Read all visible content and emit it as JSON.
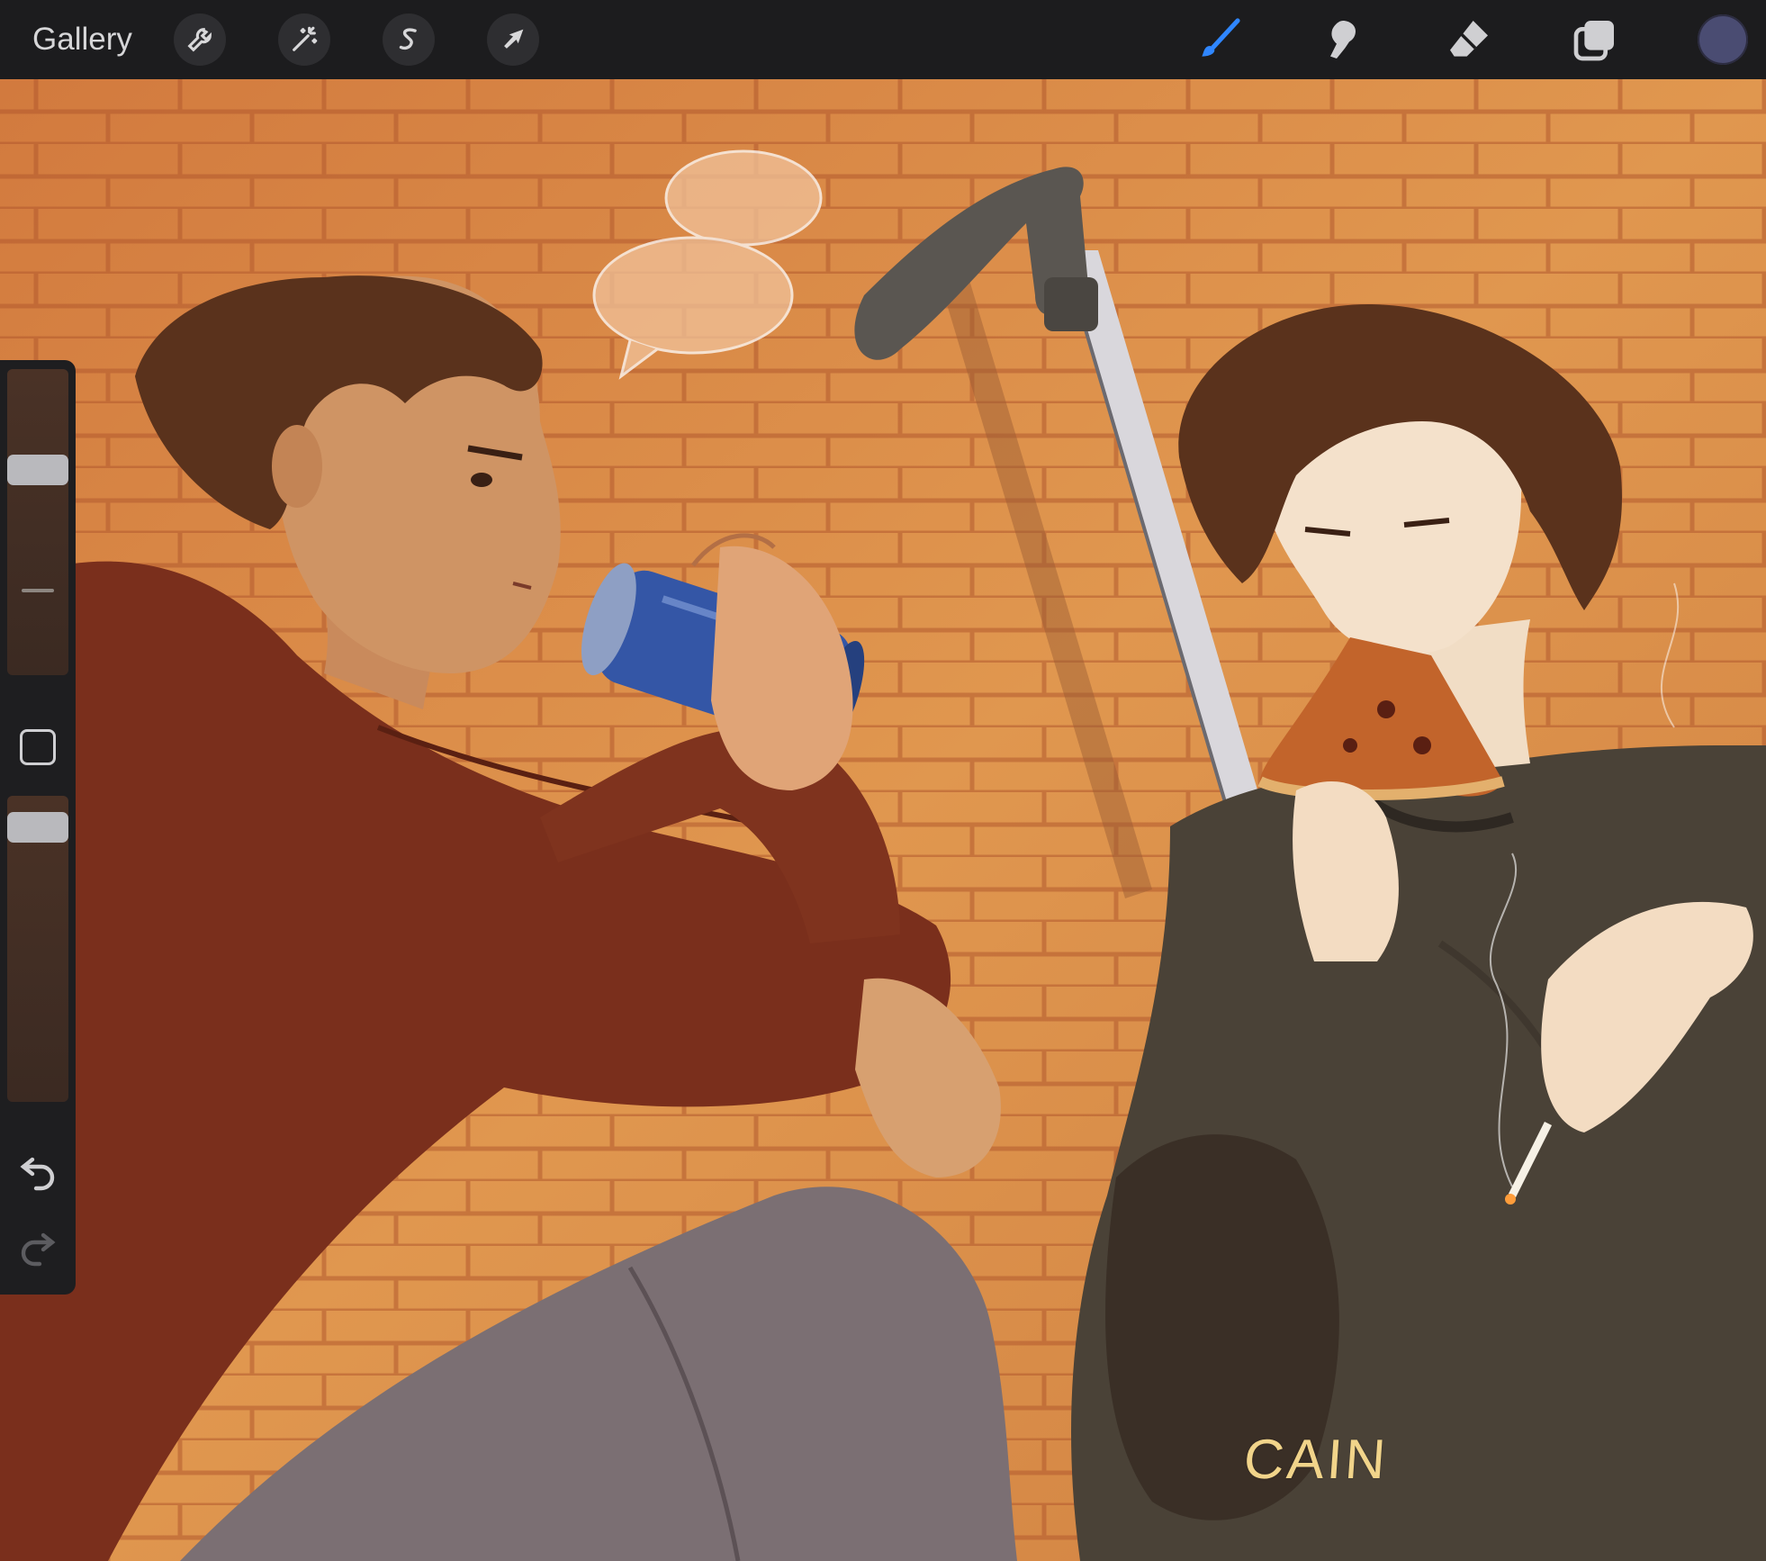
{
  "toolbar": {
    "gallery_label": "Gallery",
    "left_tools": [
      {
        "name": "actions",
        "icon": "wrench-icon"
      },
      {
        "name": "adjustments",
        "icon": "magic-wand-icon"
      },
      {
        "name": "selection",
        "icon": "selection-s-icon"
      },
      {
        "name": "transform",
        "icon": "arrow-cursor-icon"
      }
    ],
    "right_tools": [
      {
        "name": "brush",
        "icon": "brush-icon",
        "active": true,
        "color": "#2f86ff"
      },
      {
        "name": "smudge",
        "icon": "smudge-finger-icon",
        "active": false
      },
      {
        "name": "eraser",
        "icon": "eraser-icon",
        "active": false
      },
      {
        "name": "layers",
        "icon": "layers-icon",
        "active": false
      }
    ],
    "current_color": "#4a4c72"
  },
  "sidebar": {
    "brush_size_level": 0.31,
    "opacity_level": 0.06,
    "modify_button": "square-icon",
    "undo": "undo-arrow-icon",
    "redo": "redo-arrow-icon"
  },
  "canvas": {
    "signature": "CAIN",
    "colors": {
      "wall": "#d98a4a",
      "hoodie": "#7a2f1c",
      "jeans": "#7b6f73",
      "can": "#3456a6",
      "shirt": "#4a4237",
      "hair": "#5a321c"
    }
  }
}
